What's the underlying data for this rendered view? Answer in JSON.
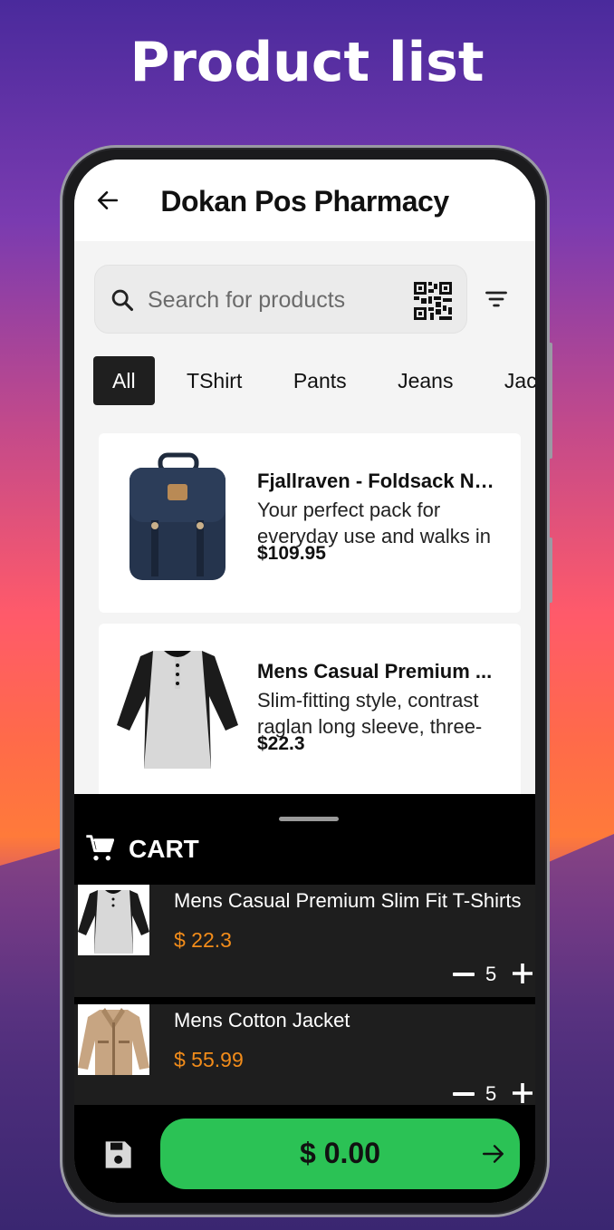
{
  "page": {
    "title": "Product list"
  },
  "appbar": {
    "title": "Dokan Pos Pharmacy",
    "back_icon": "arrow-left-icon"
  },
  "search": {
    "placeholder": "Search for products",
    "value": "",
    "scan_icon": "qr-code-icon",
    "filter_icon": "filter-icon"
  },
  "categories": [
    "All",
    "TShirt",
    "Pants",
    "Jeans",
    "Jacke"
  ],
  "categories_active": "All",
  "products": [
    {
      "name": "Fjallraven - Foldsack No. ...",
      "desc": "Your perfect pack for everyday use and walks in",
      "price": "$109.95",
      "image": "backpack-image"
    },
    {
      "name": "Mens Casual Premium ...",
      "desc": "Slim-fitting style, contrast raglan long sleeve, three-",
      "price": "$22.3",
      "image": "raglan-tshirt-image"
    }
  ],
  "cart": {
    "title": "CART",
    "icon": "cart-icon",
    "items": [
      {
        "name": "Mens Casual Premium Slim Fit T-Shirts",
        "price": "$ 22.3",
        "qty": "5",
        "image": "raglan-tshirt-image"
      },
      {
        "name": "Mens Cotton Jacket",
        "price": "$ 55.99",
        "qty": "5",
        "image": "jacket-image"
      }
    ],
    "save_icon": "save-icon",
    "total": "$ 0.00",
    "checkout_icon": "arrow-right-icon"
  },
  "colors": {
    "accent_green": "#2bc255",
    "price_orange": "#f28c1a",
    "chip_active": "#1f1f1f"
  }
}
